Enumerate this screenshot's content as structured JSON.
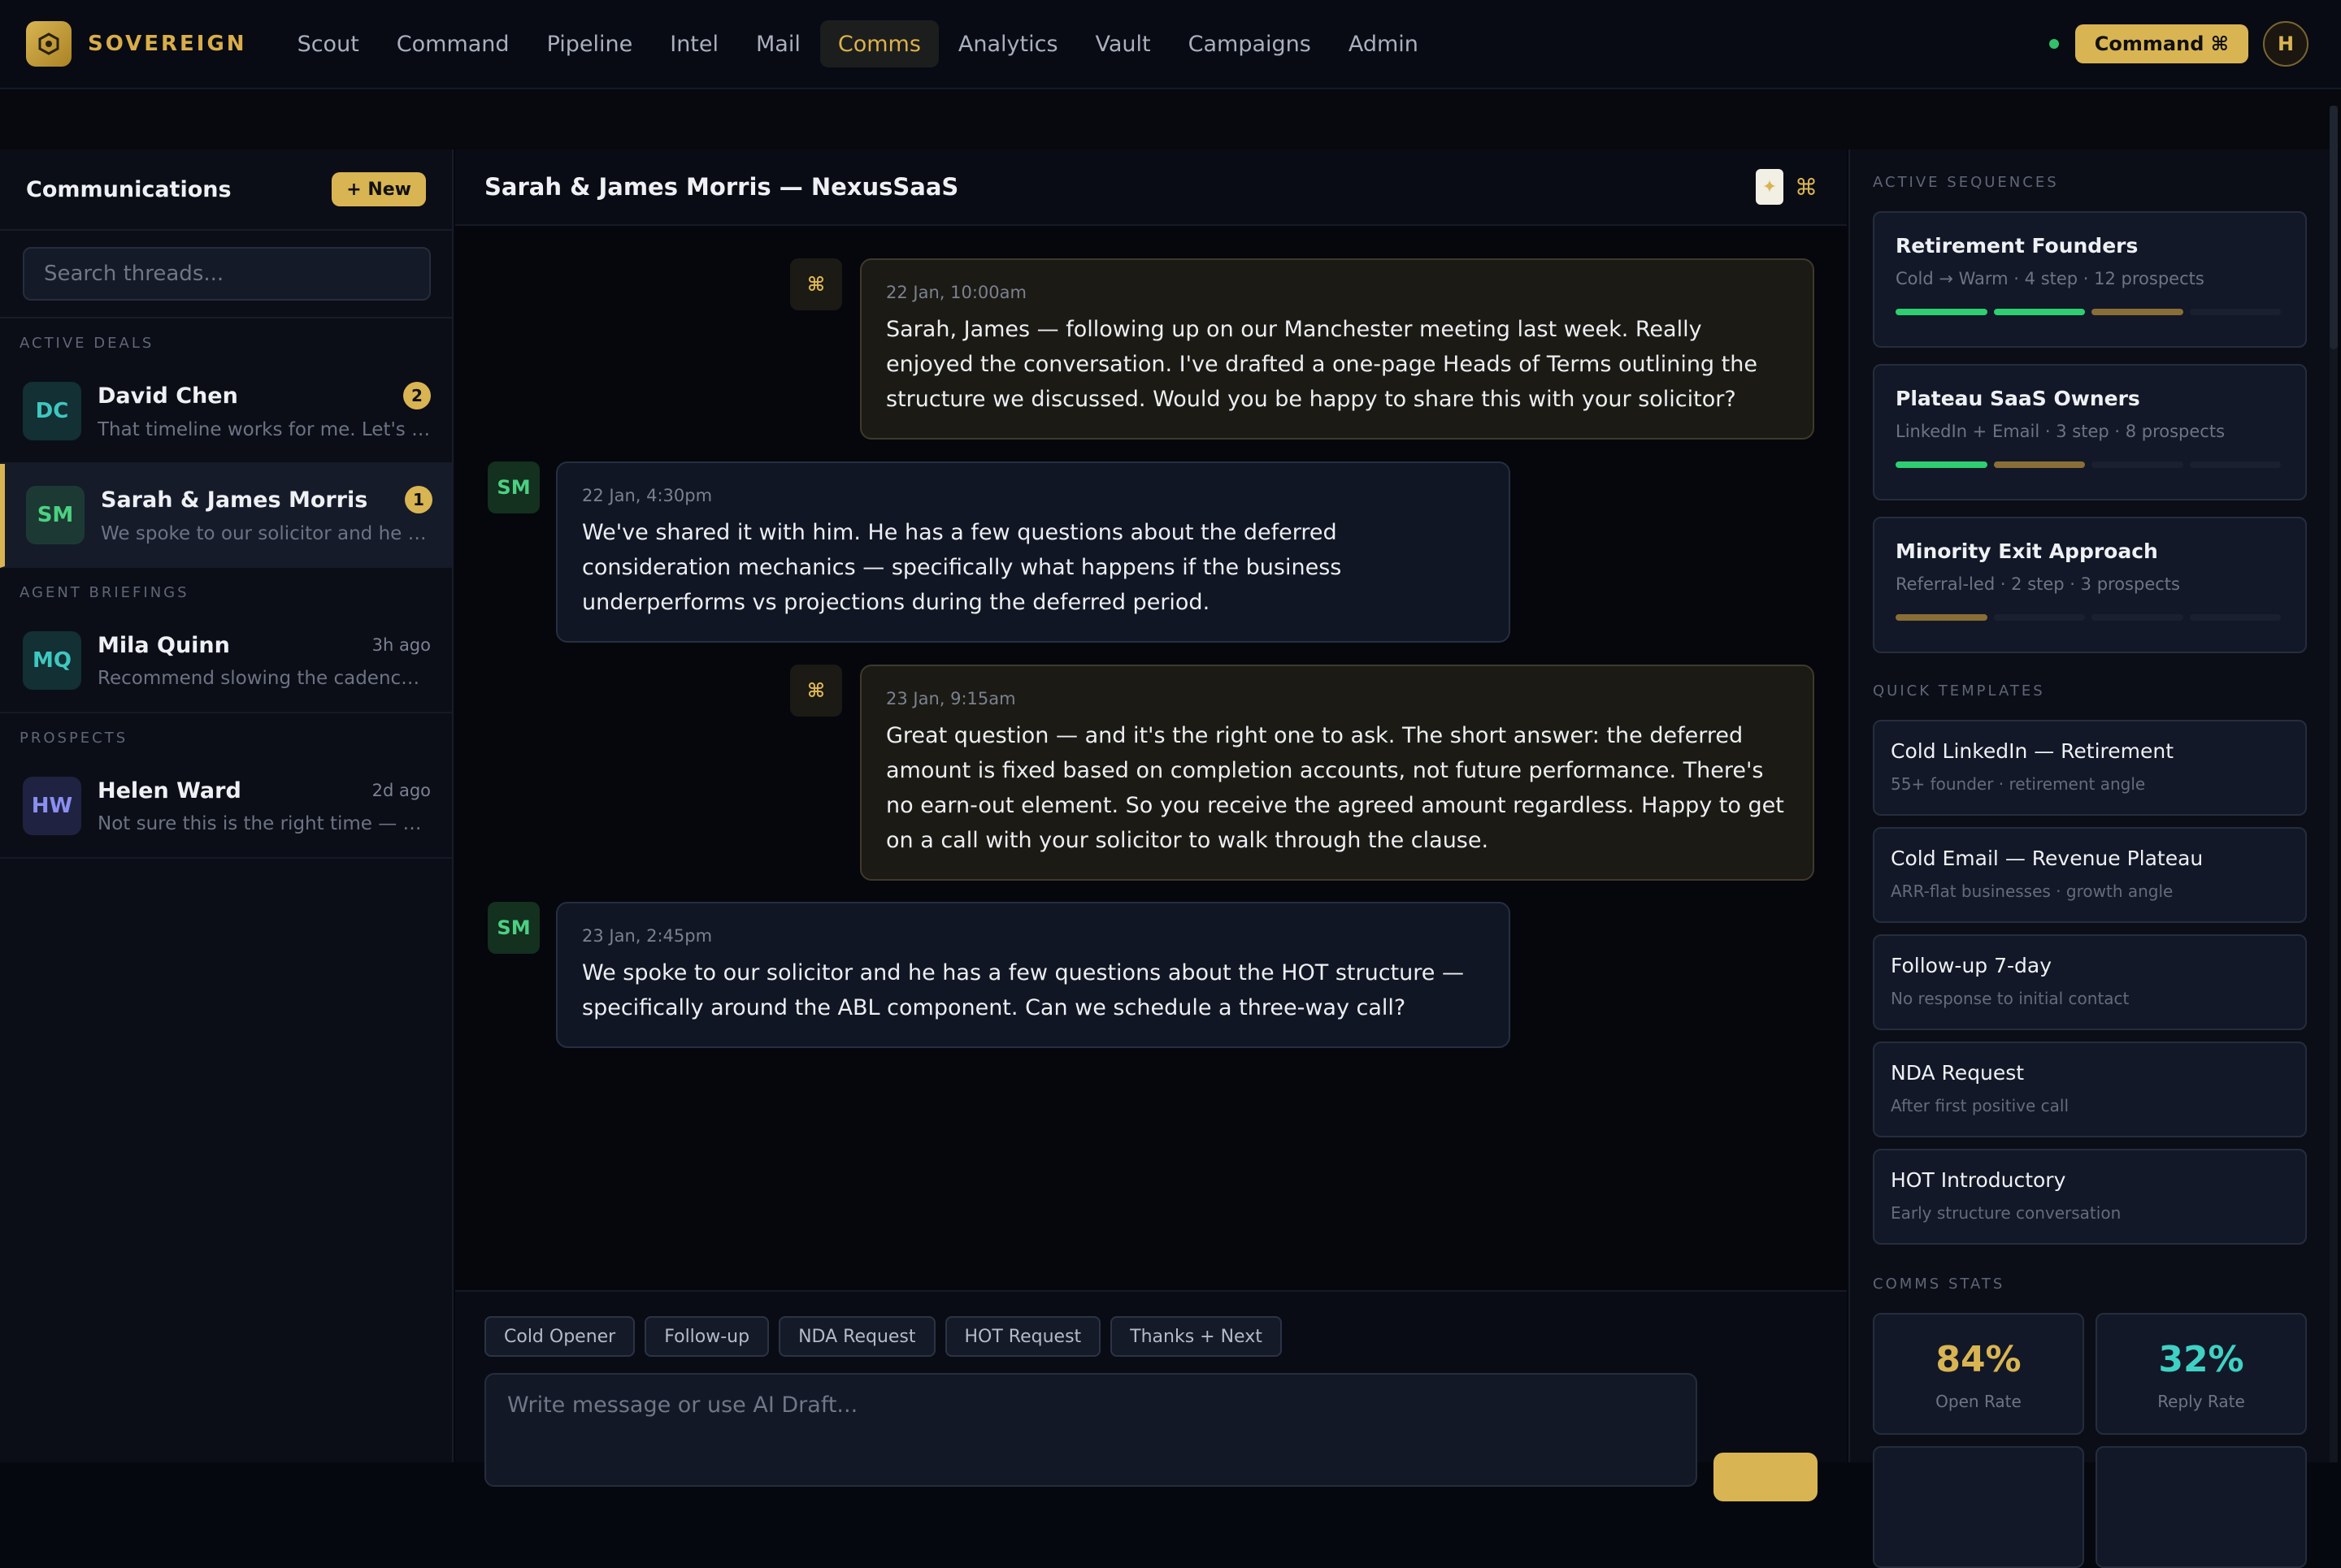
{
  "brand": {
    "name": "SOVEREIGN"
  },
  "nav": {
    "items": [
      "Scout",
      "Command",
      "Pipeline",
      "Intel",
      "Mail",
      "Comms",
      "Analytics",
      "Vault",
      "Campaigns",
      "Admin"
    ],
    "active": "Comms",
    "command_label": "Command ⌘",
    "avatar_initial": "H"
  },
  "sidebar": {
    "title": "Communications",
    "new_label": "+ New",
    "search_placeholder": "Search threads...",
    "sections": [
      {
        "label": "ACTIVE DEALS",
        "threads": [
          {
            "initials": "DC",
            "name": "David Chen",
            "badge": "2",
            "snippet": "That timeline works for me. Let's schedule",
            "avatar_bg": "#133034",
            "avatar_fg": "#3fc7c0"
          },
          {
            "initials": "SM",
            "name": "Sarah & James Morris",
            "badge": "1",
            "snippet": "We spoke to our solicitor and he has a few questions",
            "avatar_bg": "#1c3a33",
            "avatar_fg": "#4cd081",
            "active": true
          }
        ]
      },
      {
        "label": "AGENT BRIEFINGS",
        "threads": [
          {
            "initials": "MQ",
            "name": "Mila Quinn",
            "time": "3h ago",
            "snippet": "Recommend slowing the cadence on this one",
            "avatar_bg": "#133034",
            "avatar_fg": "#3fc7c0"
          }
        ]
      },
      {
        "label": "PROSPECTS",
        "threads": [
          {
            "initials": "HW",
            "name": "Helen Ward",
            "time": "2d ago",
            "snippet": "Not sure this is the right time — maybe later",
            "avatar_bg": "#1f2240",
            "avatar_fg": "#8a8ff0"
          }
        ]
      }
    ]
  },
  "conversation": {
    "title": "Sarah & James Morris — NexusSaaS",
    "messages": [
      {
        "from": "agent",
        "time": "22 Jan, 10:00am",
        "text": "Sarah, James — following up on our Manchester meeting last week. Really enjoyed the conversation. I've drafted a one-page Heads of Terms outlining the structure we discussed. Would you be happy to share this with your solicitor?"
      },
      {
        "from": "SM",
        "time": "22 Jan, 4:30pm",
        "text": "We've shared it with him. He has a few questions about the deferred consideration mechanics — specifically what happens if the business underperforms vs projections during the deferred period."
      },
      {
        "from": "agent",
        "time": "23 Jan, 9:15am",
        "text": "Great question — and it's the right one to ask. The short answer: the deferred amount is fixed based on completion accounts, not future performance. There's no earn-out element. So you receive the agreed amount regardless. Happy to get on a call with your solicitor to walk through the clause."
      },
      {
        "from": "SM",
        "time": "23 Jan, 2:45pm",
        "text": "We spoke to our solicitor and he has a few questions about the HOT structure — specifically around the ABL component. Can we schedule a three-way call?"
      }
    ],
    "agent_icon": "⌘",
    "sm_initials": "SM",
    "quick_chips": [
      "Cold Opener",
      "Follow-up",
      "NDA Request",
      "HOT Request",
      "Thanks + Next"
    ],
    "input_placeholder": "Write message or use AI Draft..."
  },
  "right_panel": {
    "sequences_label": "ACTIVE SEQUENCES",
    "sequences": [
      {
        "name": "Retirement Founders",
        "meta": "Cold → Warm · 4 step · 12 prospects",
        "steps": [
          "done",
          "done",
          "wip",
          "todo"
        ]
      },
      {
        "name": "Plateau SaaS Owners",
        "meta": "LinkedIn + Email · 3 step · 8 prospects",
        "steps": [
          "done",
          "wip",
          "todo"
        ]
      },
      {
        "name": "Minority Exit Approach",
        "meta": "Referral-led · 2 step · 3 prospects",
        "steps": [
          "wip",
          "todo"
        ]
      }
    ],
    "templates_label": "QUICK TEMPLATES",
    "templates": [
      {
        "name": "Cold LinkedIn — Retirement",
        "sub": "55+ founder · retirement angle"
      },
      {
        "name": "Cold Email — Revenue Plateau",
        "sub": "ARR-flat businesses · growth angle"
      },
      {
        "name": "Follow-up 7-day",
        "sub": "No response to initial contact"
      },
      {
        "name": "NDA Request",
        "sub": "After first positive call"
      },
      {
        "name": "HOT Introductory",
        "sub": "Early structure conversation"
      }
    ],
    "stats_label": "COMMS STATS",
    "stats": [
      {
        "value": "84%",
        "label": "Open Rate",
        "color": "#d9b453"
      },
      {
        "value": "32%",
        "label": "Reply Rate",
        "color": "#3fd1c4"
      }
    ]
  }
}
